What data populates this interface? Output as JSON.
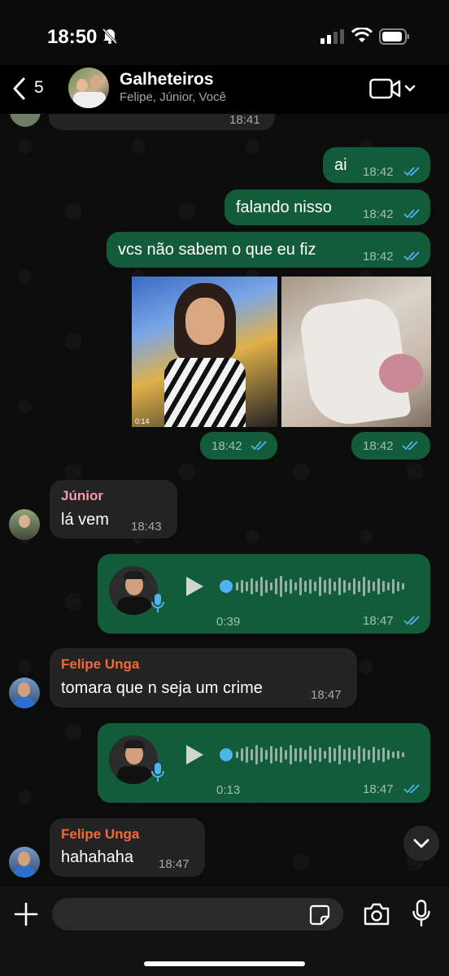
{
  "status_bar": {
    "time": "18:50"
  },
  "header": {
    "back_count": "5",
    "title": "Galheteiros",
    "subtitle": "Felipe, Júnior, Você"
  },
  "messages": {
    "prev_time": "18:41",
    "m1": {
      "text": "ai",
      "time": "18:42"
    },
    "m2": {
      "text": "falando nisso",
      "time": "18:42"
    },
    "m3": {
      "text": "vcs não sabem o que eu fiz",
      "time": "18:42"
    },
    "video1": {
      "duration": "0:14",
      "time": "18:42"
    },
    "video2": {
      "time": "18:42"
    },
    "junior": {
      "sender": "Júnior",
      "text": "lá vem",
      "time": "18:43"
    },
    "voice1": {
      "duration": "0:39",
      "time": "18:47"
    },
    "felipe1": {
      "sender": "Felipe Unga",
      "text": "tomara que n seja um crime",
      "time": "18:47"
    },
    "voice2": {
      "duration": "0:13",
      "time": "18:47"
    },
    "felipe2": {
      "sender": "Felipe Unga",
      "text": "hahahaha",
      "time": "18:47"
    }
  },
  "colors": {
    "outgoing_bubble": "#135c3a",
    "incoming_bubble": "#232323",
    "read_ticks": "#4fb3f0",
    "sender_junior": "#f59aab",
    "sender_felipe": "#f26a3b"
  }
}
